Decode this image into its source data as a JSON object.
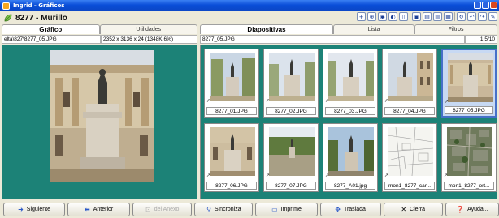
{
  "window": {
    "title": "Ingrid - Gráficos"
  },
  "header": {
    "title": "8277 - Murillo"
  },
  "toolbar": {
    "icons": [
      "zoom-in-icon",
      "zoom-fit-icon",
      "contrast-icon",
      "half-tone-icon",
      "page-icon",
      "images-icon",
      "images-2-icon",
      "image-save-icon",
      "image-edit-icon",
      "rotate-icon",
      "undo-icon",
      "redo-icon",
      "pencil-icon"
    ]
  },
  "left": {
    "tabs": [
      {
        "label": "Gráfico",
        "active": true
      },
      {
        "label": "Utilidades",
        "active": false
      }
    ],
    "path": "elta\\827\\8277_05.JPG",
    "info": "2352 x 3136 x 24  (1348K 6%)"
  },
  "right": {
    "tabs": [
      {
        "label": "Diapositivas",
        "active": true
      },
      {
        "label": "Lista",
        "active": false
      },
      {
        "label": "Filtros",
        "active": false
      }
    ],
    "current_file": "8277_05.JPG",
    "page_info": "1  5/10",
    "thumbnails": [
      {
        "caption": "8277_01.JPG",
        "selected": false
      },
      {
        "caption": "8277_02.JPG",
        "selected": false
      },
      {
        "caption": "8277_03.JPG",
        "selected": false
      },
      {
        "caption": "8277_04.JPG",
        "selected": false
      },
      {
        "caption": "8277_05.JPG",
        "selected": true
      },
      {
        "caption": "8277_06.JPG",
        "selected": false
      },
      {
        "caption": "8277_07.JPG",
        "selected": false
      },
      {
        "caption": "8277_A01.jpg",
        "selected": false
      },
      {
        "caption": "mon1_8277_car...",
        "selected": false
      },
      {
        "caption": "mon1_8277_ort...",
        "selected": false
      }
    ]
  },
  "buttons": [
    {
      "label": "Siguiente",
      "icon": "arrow-right-icon",
      "enabled": true
    },
    {
      "label": "Anterior",
      "icon": "arrow-left-icon",
      "enabled": true
    },
    {
      "label": "del Anexo",
      "icon": "attachment-icon",
      "enabled": false
    },
    {
      "label": "Sincroniza",
      "icon": "sync-icon",
      "enabled": true
    },
    {
      "label": "Imprime",
      "icon": "printer-icon",
      "enabled": true
    },
    {
      "label": "Traslada",
      "icon": "move-icon",
      "enabled": true
    },
    {
      "label": "Cierra",
      "icon": "close-icon",
      "enabled": true
    },
    {
      "label": "Ayuda...",
      "icon": "help-icon",
      "enabled": true
    }
  ]
}
